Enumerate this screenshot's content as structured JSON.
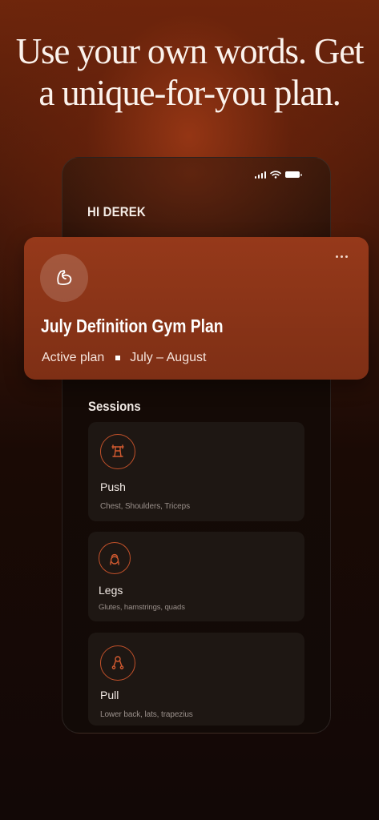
{
  "headline": {
    "line1": "Use your own words. Get",
    "line2": "a unique-for-you plan."
  },
  "greeting": "HI DEREK",
  "plan": {
    "icon": "flexed-bicep-icon",
    "title": "July Definition Gym Plan",
    "status": "Active plan",
    "date_range": "July – August",
    "more_icon": "more-horizontal-icon"
  },
  "sessions": {
    "title": "Sessions",
    "items": [
      {
        "name": "Push",
        "muscles": "Chest, Shoulders, Triceps",
        "icon": "barbell-press-icon"
      },
      {
        "name": "Legs",
        "muscles": "Glutes, hamstrings, quads",
        "icon": "kettlebell-icon"
      },
      {
        "name": "Pull",
        "muscles": "Lower back, lats, trapezius",
        "icon": "pull-handle-icon"
      }
    ]
  },
  "colors": {
    "accent": "#c2512a",
    "plan_card": "#8a3417",
    "session_card": "#1e1713"
  }
}
